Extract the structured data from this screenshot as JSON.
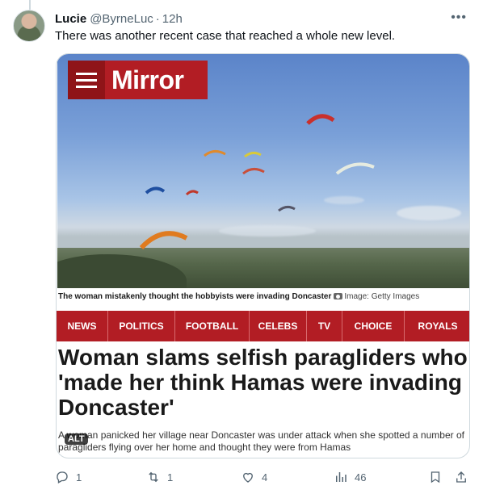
{
  "tweet": {
    "author_name": "Lucie",
    "handle": "@ByrneLuc",
    "separator": "·",
    "time": "12h",
    "text": "There was another recent case that reached a whole new level.",
    "more_icon": "more-horizontal-icon"
  },
  "card": {
    "logo_text": "Mirror",
    "caption_bold": "The woman mistakenly thought the hobbyists were invading Doncaster",
    "caption_credit": "Image: Getty Images",
    "nav": [
      "NEWS",
      "POLITICS",
      "FOOTBALL",
      "CELEBS",
      "TV",
      "CHOICE",
      "ROYALS"
    ],
    "headline": "Woman slams selfish paragliders who 'made her think Hamas were invading Doncaster'",
    "standfirst": "A woman panicked her village near Doncaster was under attack when she spotted a number of paragliders flying over her home and thought they were from Hamas",
    "alt_badge": "ALT",
    "brand_color": "#b21d24"
  },
  "actions": {
    "replies": "1",
    "reposts": "1",
    "likes": "4",
    "views": "46"
  }
}
